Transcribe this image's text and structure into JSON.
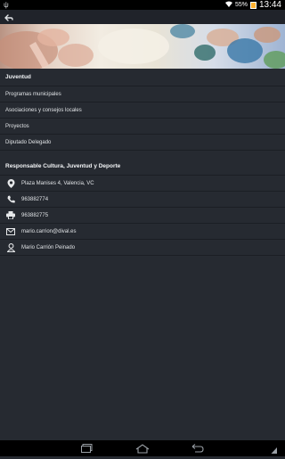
{
  "status": {
    "left_icon": "usb-icon",
    "battery": "55%",
    "time": "13:44"
  },
  "section1": {
    "title": "Juventud",
    "items": [
      {
        "label": "Programas municipales"
      },
      {
        "label": "Asociaciones y consejos locales"
      },
      {
        "label": "Proyectos"
      },
      {
        "label": "Diputado Delegado"
      }
    ]
  },
  "section2": {
    "title": "Responsable Cultura, Juventud y Deporte",
    "items": [
      {
        "icon": "location-pin-icon",
        "label": "Plaza Manises 4, Valencia, VC"
      },
      {
        "icon": "phone-icon",
        "label": "963882774"
      },
      {
        "icon": "printer-icon",
        "label": "963882775"
      },
      {
        "icon": "mail-icon",
        "label": "mario.carrion@dival.es"
      },
      {
        "icon": "person-icon",
        "label": "Mario Carrión Peinado"
      }
    ]
  }
}
